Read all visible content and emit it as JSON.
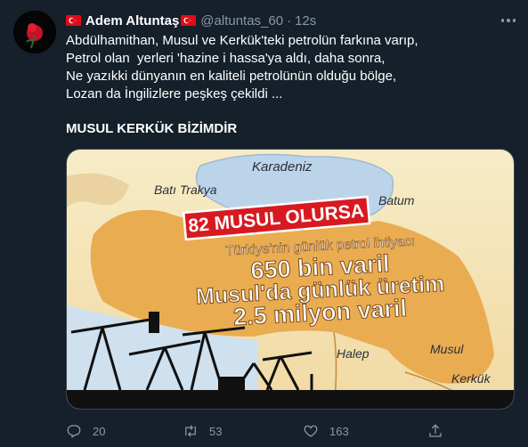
{
  "tweet": {
    "author_name": "Adem Altuntaş",
    "author_handle": "@altuntas_60",
    "separator": "·",
    "time": "12s",
    "lines": [
      "Abdülhamithan, Musul ve Kerkük'teki petrolün farkına varıp,",
      "Petrol olan  yerleri 'hazine i hassa'ya aldı, daha sonra,",
      "Ne yazıkki dünyanın en kaliteli petrolünün olduğu bölge,",
      "Lozan da İngilizlere peşkeş çekildi ..."
    ],
    "headline": "MUSUL KERKÜK BİZİMDİR"
  },
  "media": {
    "regions": {
      "karadeniz": "Karadeniz",
      "bati_trakya": "Batı Trakya",
      "batum": "Batum",
      "halep": "Halep",
      "musul": "Musul",
      "kerkuk": "Kerkük"
    },
    "banner": "82 MUSUL OLURSA",
    "subtitle": "Türkiye'nin günlük petrol ihtiyacı",
    "line1": "650 bin varil",
    "line2": "Musul'da günlük üretim",
    "line3": "2.5 milyon varil"
  },
  "actions": {
    "reply_count": "20",
    "retweet_count": "53",
    "like_count": "163"
  },
  "colors": {
    "background": "#15202b",
    "muted": "#8899a6",
    "banner_red": "#d71920",
    "sea_blue": "#bcd4ea",
    "land": "#f3e1b0",
    "territory": "#e9a94b"
  }
}
